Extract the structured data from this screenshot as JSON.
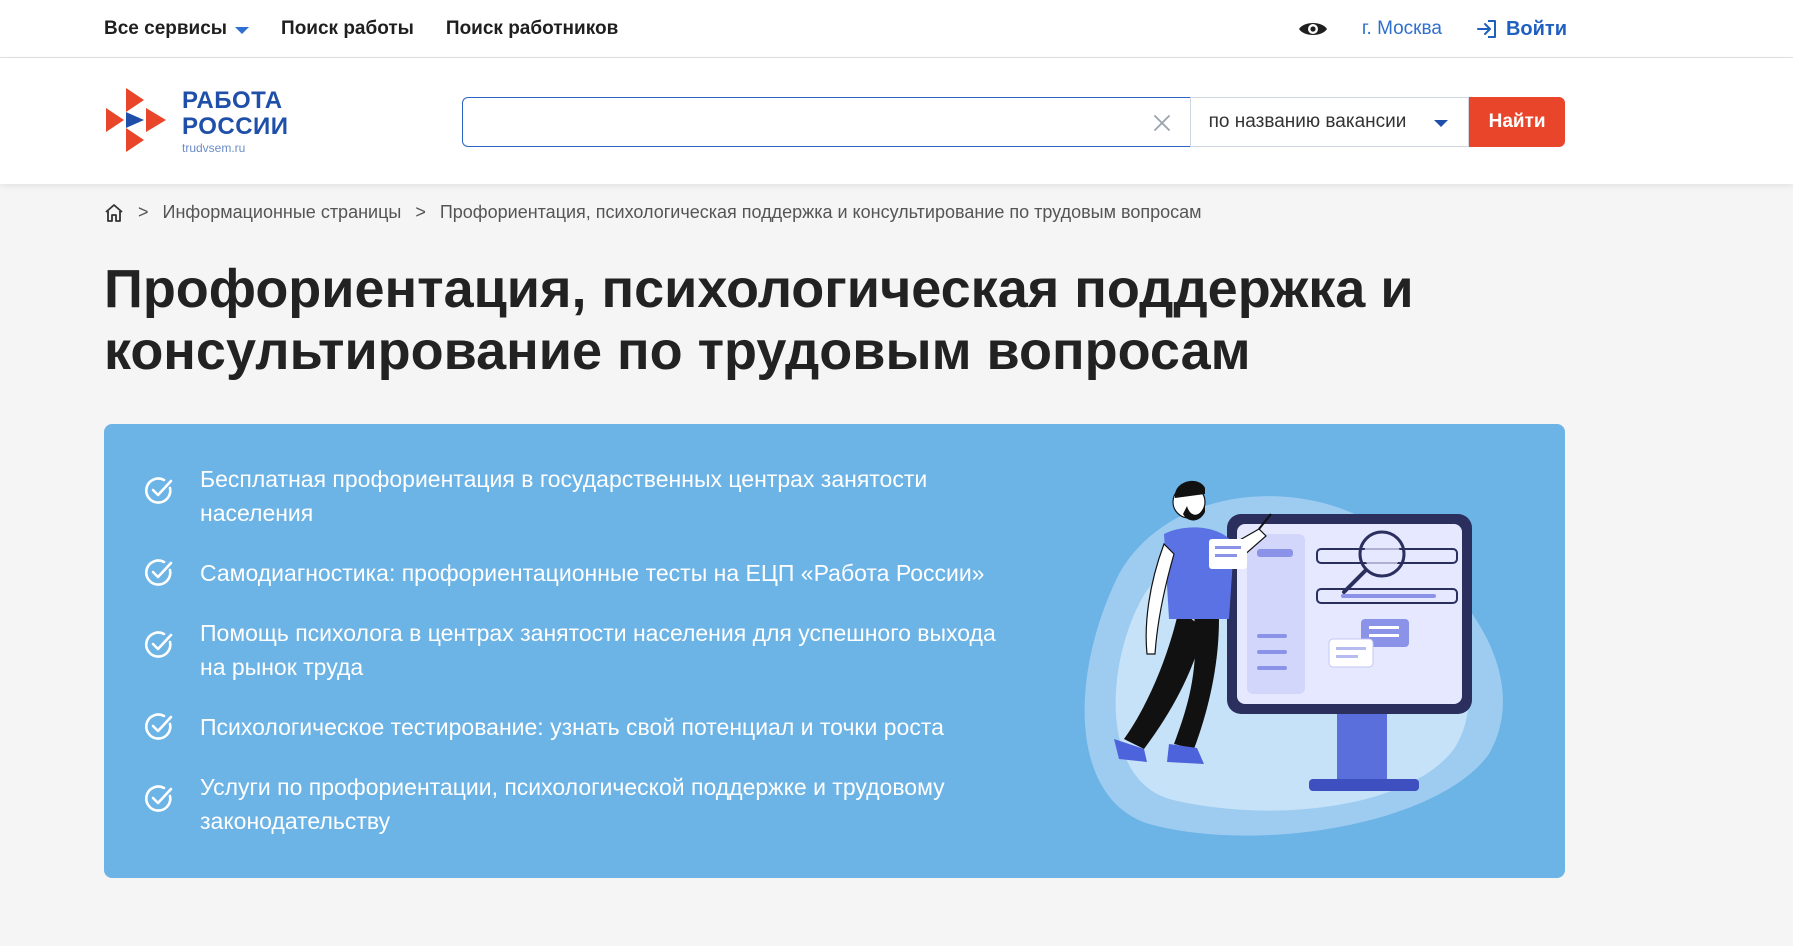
{
  "topnav": {
    "all_services": "Все сервисы",
    "job_search": "Поиск работы",
    "employee_search": "Поиск работников"
  },
  "topright": {
    "city": "г. Москва",
    "login": "Войти"
  },
  "logo": {
    "line1": "РАБОТА",
    "line2": "РОССИИ",
    "domain": "trudvsem.ru"
  },
  "search": {
    "value": "",
    "placeholder": "",
    "mode": "по названию вакансии",
    "button": "Найти"
  },
  "breadcrumb": {
    "level1": "Информационные страницы",
    "current": "Профориентация, психологическая поддержка и консультирование по трудовым вопросам",
    "separator": ">"
  },
  "title": {
    "line1": "Профориентация, психологическая поддержка и",
    "line2": "консультирование по трудовым вопросам"
  },
  "features": [
    "Бесплатная профориентация в государственных центрах занятости населения",
    "Самодиагностика: профориентационные тесты на ЕЦП «Работа России»",
    "Помощь психолога в центрах занятости населения для успешного выхода на рынок труда",
    "Психологическое тестирование: узнать свой потенциал и точки роста",
    "Услуги по профориентации, психологической поддержке и трудовому законодательству"
  ],
  "colors": {
    "brand_blue": "#1f4fa8",
    "accent_orange": "#e8452a",
    "link_blue": "#2f6fcf",
    "banner_blue": "#6cb3e6"
  },
  "icons": [
    "chevron-down-icon",
    "eye-icon",
    "login-icon",
    "logo-arrows-icon",
    "close-icon",
    "home-icon",
    "check-circle-icon"
  ]
}
